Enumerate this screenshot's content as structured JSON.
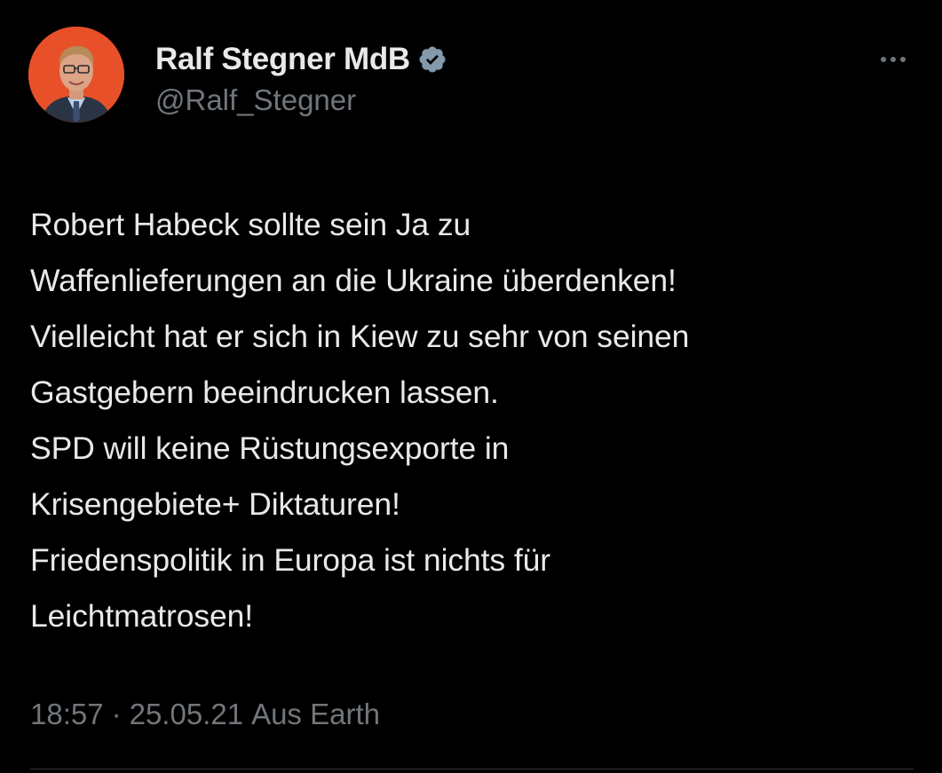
{
  "author": {
    "display_name": "Ralf Stegner MdB",
    "handle": "@Ralf_Stegner",
    "verified_icon": "verified-badge-icon",
    "avatar_bg": "#e8502a"
  },
  "more_icon": "more-horizontal-icon",
  "tweet": {
    "lines": [
      "Robert Habeck sollte sein Ja zu",
      "Waffenlieferungen an die Ukraine überdenken!",
      "Vielleicht hat er sich in Kiew zu sehr von seinen",
      "Gastgebern beeindrucken lassen.",
      "SPD will keine Rüstungsexporte in",
      "Krisengebiete+ Diktaturen!",
      "Friedenspolitik in Europa ist nichts für",
      "Leichtmatrosen!"
    ]
  },
  "meta": {
    "time": "18:57",
    "separator": "·",
    "date": "25.05.21",
    "source": "Aus Earth"
  },
  "colors": {
    "background": "#000000",
    "text": "#e7e9ea",
    "secondary": "#71767b",
    "divider": "#2f3336"
  }
}
